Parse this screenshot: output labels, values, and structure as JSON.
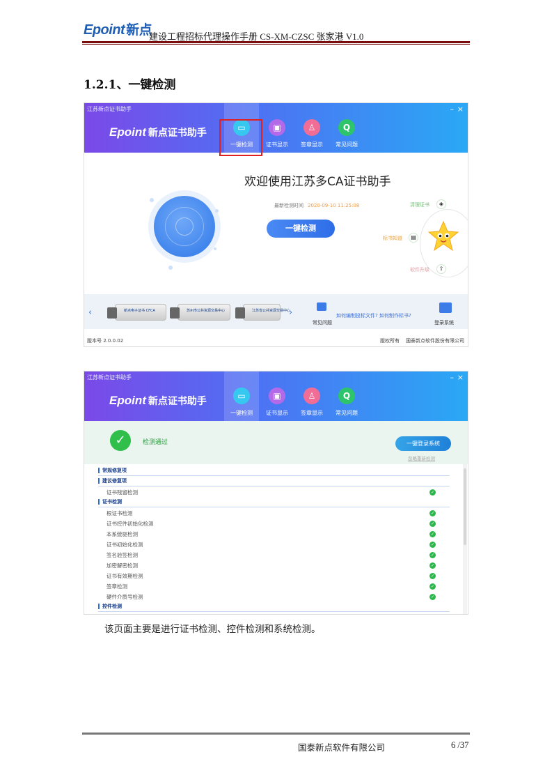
{
  "page_header": {
    "logo_text": "Epoint",
    "logo_cn": "新点",
    "doc_title": "建设工程招标代理操作手册 CS-XM-CZSC 张家港 V1.0"
  },
  "section_heading": "1.2.1、一键检测",
  "app": {
    "window_title": "江苏新点证书助手",
    "minimize_icon": "–",
    "close_icon": "×",
    "brand_latin": "Epoint",
    "brand_cn": "新点证书助手",
    "tabs": [
      {
        "label": "一键检测",
        "icon": "monitor-icon"
      },
      {
        "label": "证书显示",
        "icon": "certificate-icon"
      },
      {
        "label": "签章显示",
        "icon": "stamp-icon"
      },
      {
        "label": "常见问题",
        "icon": "question-icon"
      }
    ]
  },
  "screen1": {
    "welcome": "欢迎使用江苏多CA证书助手",
    "last_check_label": "最新检测时间",
    "last_check_time": "2020-09-10 11:25:08",
    "check_button": "一键检测",
    "side_links": {
      "clean_cert": "清理证书",
      "bid_know": "标书知道",
      "upgrade": "软件升级"
    },
    "usb_labels": [
      "新点电子证书 CFCA",
      "苏州市公共资源交易中心",
      "江苏省公共资源交易中心"
    ],
    "faq_label": "常见问题",
    "faq_links": "如何编制投标文件?  如何制作标书?",
    "login_label": "登录系统",
    "version": "版本号 2.0.0.02",
    "rights": "版权所有",
    "owner": "国泰新点软件股份有限公司"
  },
  "screen2": {
    "pass_text": "检测通过",
    "login_button": "一键登录系统",
    "recheck_link": "忽略重新检测",
    "sections": [
      {
        "title": "常规修复项",
        "items": []
      },
      {
        "title": "建议修复项",
        "items": [
          "证书残留检测"
        ]
      },
      {
        "title": "证书检测",
        "items": [
          "根证书检测",
          "证书控件初始化检测",
          "本系统驱检测",
          "证书初始化检测",
          "签名验签检测",
          "加密解密检测",
          "证书有效期检测",
          "签章检测",
          "硬件介质号检测"
        ]
      },
      {
        "title": "控件检测",
        "items": []
      }
    ]
  },
  "caption": "该页面主要是进行证书检测、控件检测和系统检测。",
  "page_footer": {
    "company": "国泰新点软件有限公司",
    "page_number": "6 /37"
  },
  "colors": {
    "header_gradient_start": "#7b49e8",
    "header_gradient_end": "#2aa8f5",
    "primary_button": "#2e6de8",
    "success_green": "#2bb84a",
    "highlight_red": "#e02020",
    "doc_rule": "#7a0d0d"
  }
}
